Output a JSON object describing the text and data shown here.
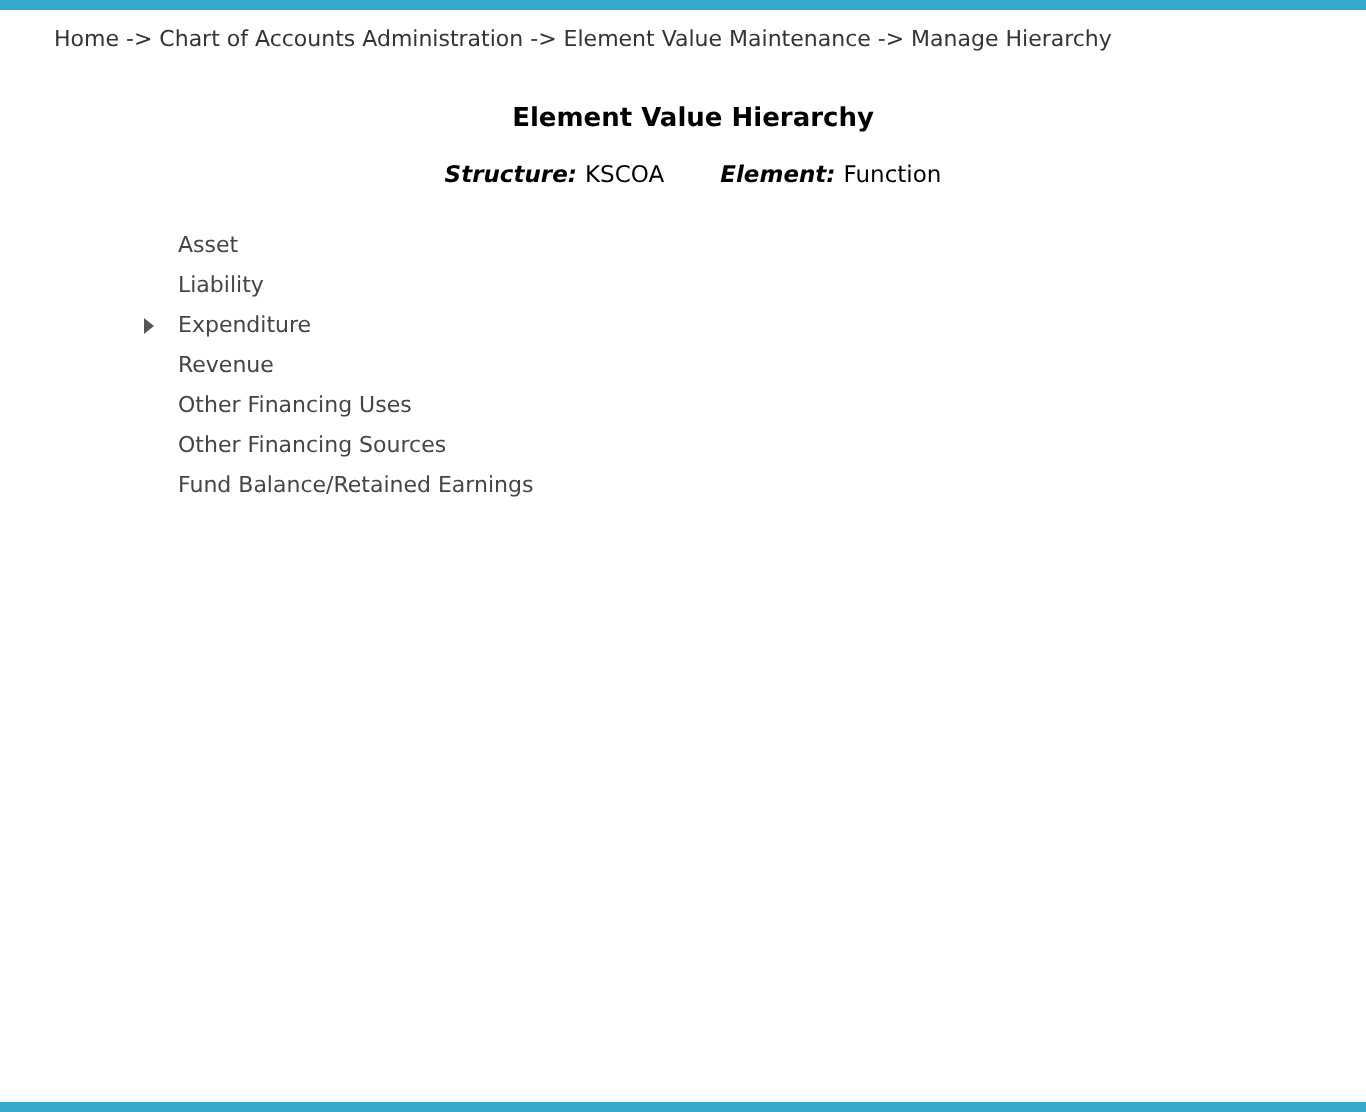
{
  "breadcrumb": "Home -> Chart of Accounts Administration -> Element Value Maintenance -> Manage Hierarchy",
  "title": "Element Value Hierarchy",
  "info": [
    {
      "label": "Structure:",
      "value": "KSCOA"
    },
    {
      "label": "Element:",
      "value": "Function"
    }
  ],
  "tree": [
    {
      "label": "Asset",
      "expandable": false
    },
    {
      "label": "Liability",
      "expandable": false
    },
    {
      "label": "Expenditure",
      "expandable": true
    },
    {
      "label": "Revenue",
      "expandable": false
    },
    {
      "label": "Other Financing Uses",
      "expandable": false
    },
    {
      "label": "Other Financing Sources",
      "expandable": false
    },
    {
      "label": "Fund Balance/Retained Earnings",
      "expandable": false
    }
  ]
}
